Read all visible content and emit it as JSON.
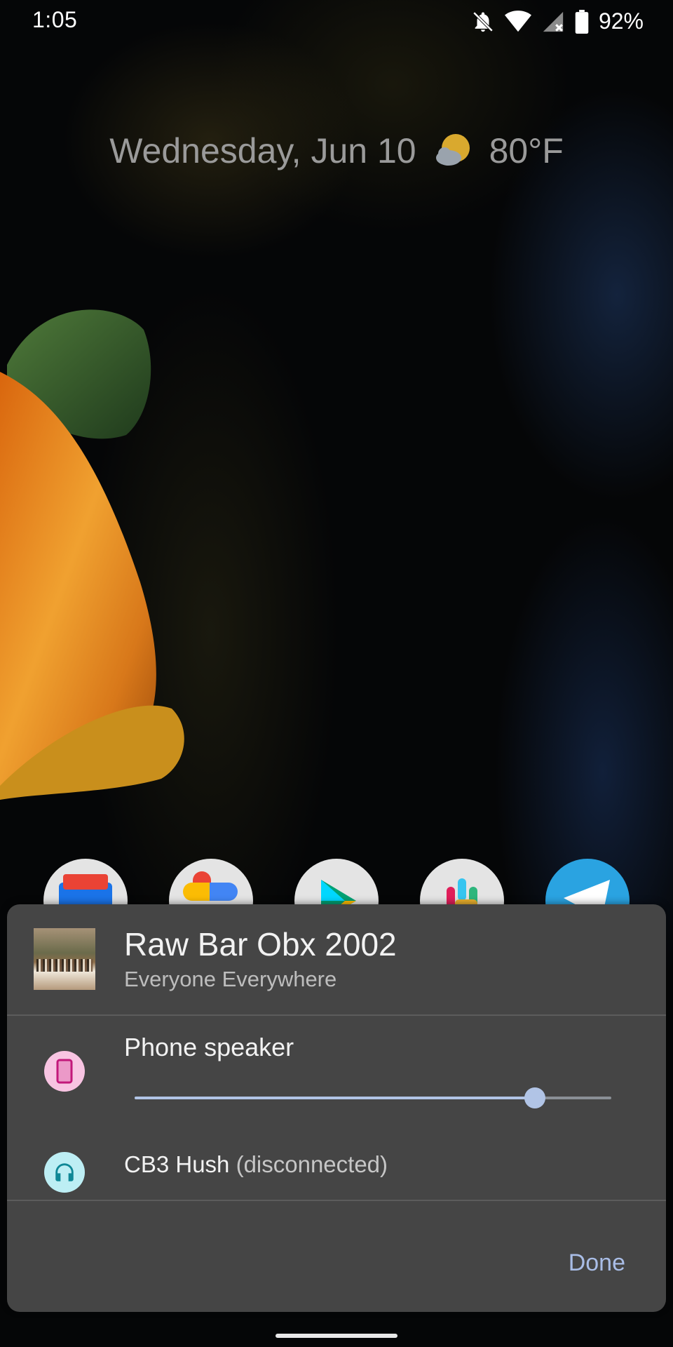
{
  "status_bar": {
    "time": "1:05",
    "battery_percent": "92%",
    "icons": [
      "notifications-off-icon",
      "wifi-icon",
      "signal-no-service-icon",
      "battery-icon"
    ]
  },
  "home": {
    "date": "Wednesday, Jun 10",
    "weather_icon": "partly-cloudy-icon",
    "temperature": "80°F",
    "dock_icons": [
      "google-news-icon",
      "google-photos-icon",
      "play-store-icon",
      "slack-icon",
      "telegram-icon"
    ]
  },
  "output_panel": {
    "media": {
      "title": "Raw Bar Obx 2002",
      "artist": "Everyone Everywhere",
      "album_art_icon": "album-art"
    },
    "devices": [
      {
        "label": "Phone speaker",
        "icon": "phone-icon",
        "icon_bg": "#f8c4e2",
        "icon_color": "#c2187a",
        "volume_fraction": 0.84
      },
      {
        "label": "CB3 Hush",
        "status": "(disconnected)",
        "icon": "headphones-icon",
        "icon_bg": "#bdeef4",
        "icon_color": "#0f8796"
      }
    ],
    "done_label": "Done",
    "accent_color": "#a9bde6"
  }
}
